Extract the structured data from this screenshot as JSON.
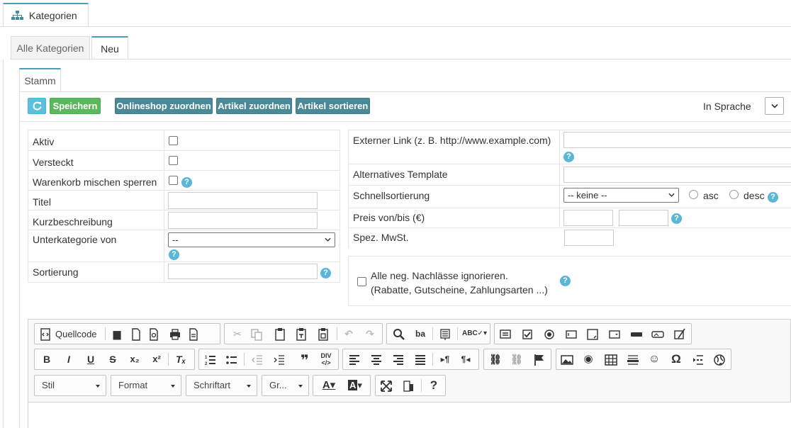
{
  "header": {
    "title": "Kategorien"
  },
  "tabs": [
    {
      "label": "Alle Kategorien"
    },
    {
      "label": "Neu"
    }
  ],
  "subtabs": [
    {
      "label": "Stamm"
    }
  ],
  "toolbar": {
    "save_label": "Speichern",
    "onlineshop_label": "Onlineshop zuordnen",
    "artikel_zuordnen_label": "Artikel zuordnen",
    "artikel_sortieren_label": "Artikel sortieren",
    "language_label": "In Sprache"
  },
  "left_form": {
    "aktiv": "Aktiv",
    "versteckt": "Versteckt",
    "warenkorb": "Warenkorb mischen sperren",
    "titel": "Titel",
    "kurzbeschreibung": "Kurzbeschreibung",
    "unterkategorie": "Unterkategorie von",
    "unterkategorie_value": "--",
    "sortierung": "Sortierung"
  },
  "right_form": {
    "externer_link": "Externer Link (z. B. http://www.example.com)",
    "alt_template": "Alternatives Template",
    "schnellsortierung": "Schnellsortierung",
    "schnellsortierung_value": "-- keine --",
    "asc": "asc",
    "desc": "desc",
    "preis": "Preis von/bis (€)",
    "mwst": "Spez. MwSt."
  },
  "discount": {
    "line1": "Alle neg. Nachlässe ignorieren.",
    "line2": "(Rabatte, Gutscheine, Zahlungsarten ...)"
  },
  "editor": {
    "source_label": "Quellcode",
    "style_label": "Stil",
    "format_label": "Format",
    "font_label": "Schriftart",
    "size_label": "Gr...",
    "help_glyph": "?"
  },
  "help_glyph": "?"
}
